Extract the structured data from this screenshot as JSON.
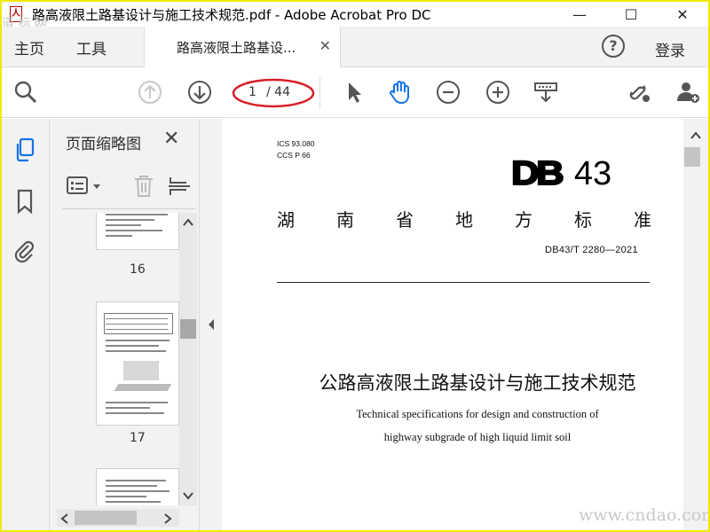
{
  "window": {
    "title": "路高液限土路基设计与施工技术规范.pdf - Adobe Acrobat Pro DC",
    "controls": [
      "—",
      "☐",
      "✕"
    ]
  },
  "menu": {
    "home": "主页",
    "tools": "工具",
    "doc_tab": "路高液限土路基设...",
    "login": "登录",
    "help": "?"
  },
  "toolbar": {
    "page_current": "1",
    "page_total": "/ 44"
  },
  "thumbnails": {
    "title": "页面缩略图",
    "pages": [
      "16",
      "17"
    ]
  },
  "document": {
    "ics_line1": "ICS 93.080",
    "ics_line2": "CCS P 66",
    "db_logo": "DB",
    "db_number": "43",
    "province_chars": [
      "湖",
      "南",
      "省",
      "地",
      "方",
      "标",
      "准"
    ],
    "standard_number": "DB43/T 2280—2021",
    "title_cn": "公路高液限土路基设计与施工技术规范",
    "title_en_line1": "Technical specifications for design and construction of",
    "title_en_line2": "highway subgrade of high liquid limit soil"
  },
  "watermarks": {
    "site": "www.cndao.com",
    "corner": "道 标 网"
  },
  "colors": {
    "frame": "#f0ea00",
    "accent_blue": "#1473e6",
    "annotation_red": "#d8202a"
  }
}
